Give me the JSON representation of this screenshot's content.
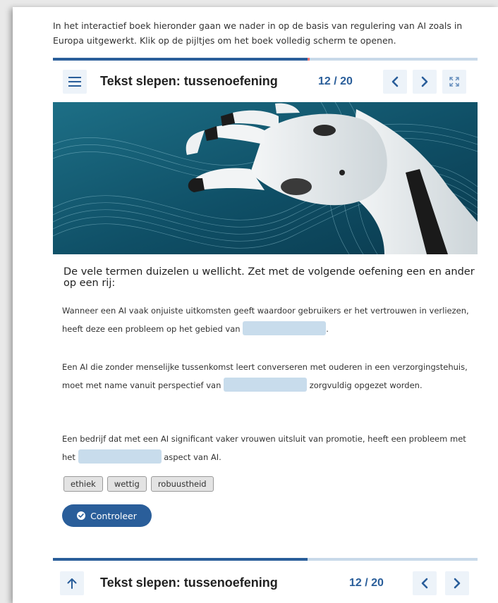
{
  "intro_text": "In het interactief boek hieronder gaan we nader in op de basis van regulering van AI zoals in Europa uitgewerkt. Klik op de pijltjes om het boek volledig scherm te openen.",
  "progress": 0.6,
  "navbar": {
    "title": "Tekst slepen: tussenoefening",
    "page_count": "12 / 20",
    "menu_icon": "hamburger-menu-icon",
    "prev_icon": "chevron-left-icon",
    "next_icon": "chevron-right-icon",
    "fullscreen_icon": "fullscreen-icon"
  },
  "footer": {
    "title": "Tekst slepen: tussenoefening",
    "page_count": "12 / 20",
    "top_icon": "arrow-up-icon"
  },
  "hero_image": "robot-hand-image",
  "question": "De vele termen duizelen u wellicht. Zet met de volgende oefening een en ander op een rij:",
  "sentences": [
    {
      "before": "Wanneer een AI vaak onjuiste uitkomsten geeft waardoor gebruikers er het vertrouwen in verliezen, heeft deze een probleem op het gebied van",
      "after": "."
    },
    {
      "before": "Een AI die zonder menselijke tussenkomst leert converseren met ouderen in een verzorgingstehuis, moet met name vanuit perspectief van",
      "after": "zorgvuldig opgezet worden."
    },
    {
      "before": "Een bedrijf dat met een AI significant vaker vrouwen uitsluit van promotie, heeft een probleem met het",
      "after": "aspect van AI."
    }
  ],
  "options": [
    "ethiek",
    "wettig",
    "robuustheid"
  ],
  "check_button": "Controleer",
  "colors": {
    "primary": "#2a5e9a",
    "blank": "#c8dcec",
    "progress_track": "#c8d9e9",
    "progress_marker": "#f07676"
  }
}
